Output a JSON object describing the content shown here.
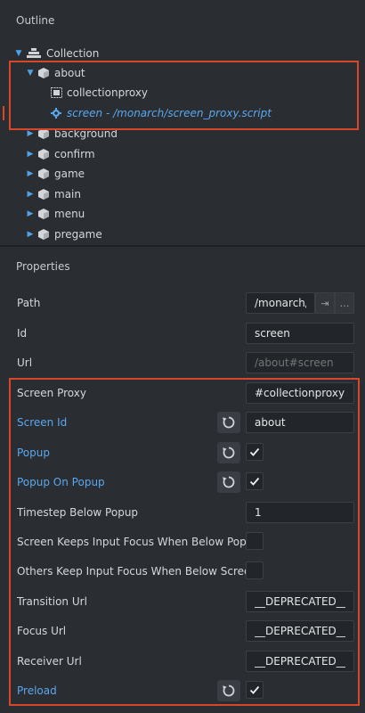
{
  "outline": {
    "title": "Outline",
    "root": {
      "label": "Collection"
    },
    "about": {
      "label": "about"
    },
    "collectionproxy": {
      "label": "collectionproxy"
    },
    "script": {
      "label": "screen - /monarch/screen_proxy.script"
    },
    "children": [
      "background",
      "confirm",
      "game",
      "main",
      "menu",
      "pregame"
    ]
  },
  "properties": {
    "title": "Properties",
    "path": {
      "label": "Path",
      "value": "/monarch/s"
    },
    "id": {
      "label": "Id",
      "value": "screen"
    },
    "url": {
      "label": "Url",
      "placeholder": "/about#screen"
    },
    "screen_proxy": {
      "label": "Screen Proxy",
      "value": "#collectionproxy"
    },
    "screen_id": {
      "label": "Screen Id",
      "value": "about"
    },
    "popup": {
      "label": "Popup",
      "checked": true
    },
    "popup_on_popup": {
      "label": "Popup On Popup",
      "checked": true
    },
    "timestep": {
      "label": "Timestep Below Popup",
      "value": "1"
    },
    "keeps_focus": {
      "label": "Screen Keeps Input Focus When Below Popup",
      "checked": false
    },
    "others_focus": {
      "label": "Others Keep Input Focus When Below Screen",
      "checked": false
    },
    "transition_url": {
      "label": "Transition Url",
      "value": "__DEPRECATED__"
    },
    "focus_url": {
      "label": "Focus Url",
      "value": "__DEPRECATED__"
    },
    "receiver_url": {
      "label": "Receiver Url",
      "value": "__DEPRECATED__"
    },
    "preload": {
      "label": "Preload",
      "checked": true
    }
  },
  "colors": {
    "accent": "#5aa8ee",
    "highlight": "#d9472b",
    "background": "#2a2d31"
  }
}
